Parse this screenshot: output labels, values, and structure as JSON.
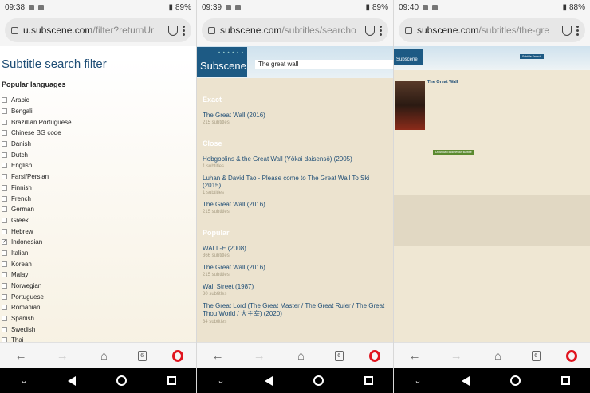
{
  "screens": [
    {
      "status": {
        "time": "09:38",
        "battery": "89%"
      },
      "url": {
        "main": "u.subscene.com",
        "dim": "/filter?returnUr"
      },
      "title": "Subtitle search filter",
      "subtitle": "Popular languages",
      "languages": [
        {
          "label": "Arabic",
          "checked": false
        },
        {
          "label": "Bengali",
          "checked": false
        },
        {
          "label": "Brazillian Portuguese",
          "checked": false
        },
        {
          "label": "Chinese BG code",
          "checked": false
        },
        {
          "label": "Danish",
          "checked": false
        },
        {
          "label": "Dutch",
          "checked": false
        },
        {
          "label": "English",
          "checked": false
        },
        {
          "label": "Farsi/Persian",
          "checked": false
        },
        {
          "label": "Finnish",
          "checked": false
        },
        {
          "label": "French",
          "checked": false
        },
        {
          "label": "German",
          "checked": false
        },
        {
          "label": "Greek",
          "checked": false
        },
        {
          "label": "Hebrew",
          "checked": false
        },
        {
          "label": "Indonesian",
          "checked": true
        },
        {
          "label": "Italian",
          "checked": false
        },
        {
          "label": "Korean",
          "checked": false
        },
        {
          "label": "Malay",
          "checked": false
        },
        {
          "label": "Norwegian",
          "checked": false
        },
        {
          "label": "Portuguese",
          "checked": false
        },
        {
          "label": "Romanian",
          "checked": false
        },
        {
          "label": "Spanish",
          "checked": false
        },
        {
          "label": "Swedish",
          "checked": false
        },
        {
          "label": "Thai",
          "checked": false
        }
      ]
    },
    {
      "status": {
        "time": "09:39",
        "battery": "89%"
      },
      "url": {
        "main": "subscene.com",
        "dim": "/subtitles/searcho"
      },
      "logo": "Subscene",
      "search_value": "The great wall",
      "sections": [
        {
          "heading": "Exact",
          "items": [
            {
              "title": "The Great Wall (2016)",
              "count": "215 subtitles"
            }
          ]
        },
        {
          "heading": "Close",
          "items": [
            {
              "title": "Hobgoblins & the Great Wall (Yōkai daisensō) (2005)",
              "count": "1 subtitles"
            },
            {
              "title": "Luhan & David Tao - Please come to The Great Wall To Ski (2015)",
              "count": "1 subtitles"
            },
            {
              "title": "The Great Wall (2016)",
              "count": "215 subtitles"
            }
          ]
        },
        {
          "heading": "Popular",
          "items": [
            {
              "title": "WALL-E (2008)",
              "count": "366 subtitles"
            },
            {
              "title": "The Great Wall (2016)",
              "count": "215 subtitles"
            },
            {
              "title": "Wall Street (1987)",
              "count": "30 subtitles"
            },
            {
              "title": "The Great Lord (The Great Master / The Great Ruler / The Great Thou World / 大主宰) (2020)",
              "count": "34 subtitles"
            }
          ]
        }
      ]
    },
    {
      "status": {
        "time": "09:40",
        "battery": "88%"
      },
      "url": {
        "main": "subscene.com",
        "dim": "/subtitles/the-gre"
      },
      "logo": "Subscene",
      "search_button": "Subtitle Search",
      "movie_title": "The Great Wall",
      "download_label": "Download Indonesian subtitle"
    }
  ]
}
